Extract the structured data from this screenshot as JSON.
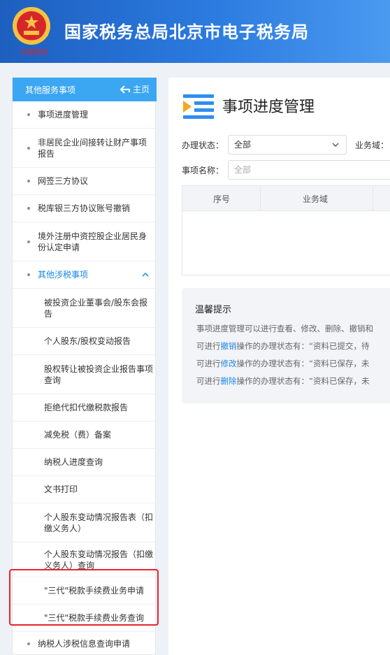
{
  "header": {
    "title": "国家税务总局北京市电子税务局",
    "emblem_text": "中国税务"
  },
  "sidebar": {
    "heading": "其他服务事项",
    "home_label": "主页",
    "items": [
      {
        "label": "事项进度管理"
      },
      {
        "label": "非居民企业间接转让财产事项报告"
      },
      {
        "label": "网签三方协议"
      },
      {
        "label": "税库银三方协议账号撤销"
      },
      {
        "label": "境外注册中资控股企业居民身份认定申请"
      },
      {
        "label": "其他涉税事项",
        "expanded": true
      },
      {
        "label": "被投资企业董事会/股东会报告"
      },
      {
        "label": "个人股东/股权变动报告"
      },
      {
        "label": "股权转让被投资企业报告事项查询"
      },
      {
        "label": "拒绝代扣代缴税款报告"
      },
      {
        "label": "减免税（费）备案"
      },
      {
        "label": "纳税人进度查询"
      },
      {
        "label": "文书打印"
      },
      {
        "label": "个人股东变动情况报告表（扣缴义务人）"
      },
      {
        "label": "个人股东变动情况报告（扣缴义务人）查询"
      },
      {
        "label": "\"三代\"税款手续费业务申请"
      },
      {
        "label": "\"三代\"税款手续费业务查询"
      },
      {
        "label": "纳税人涉税信息查询申请"
      }
    ]
  },
  "main": {
    "title": "事项进度管理",
    "status_label": "办理状态：",
    "status_value": "全部",
    "domain_label": "业务域：",
    "name_label": "事项名称：",
    "name_placeholder": "全部",
    "table_headers": [
      "序号",
      "业务域"
    ],
    "tips": {
      "title": "温馨提示",
      "line1": "事项进度管理可以进行查看、修改、删除、撤销和",
      "line2_prefix": "可进行",
      "line2_kw": "撤销",
      "line2_suffix": "操作的办理状态有：“资料已提交，待",
      "line3_prefix": "可进行",
      "line3_kw": "修改",
      "line3_suffix": "操作的办理状态有：“资料已保存，未",
      "line4_prefix": "可进行",
      "line4_kw": "删除",
      "line4_suffix": "操作的办理状态有：“资料已保存，未"
    }
  },
  "colors": {
    "header_blue": "#2c7be0",
    "sidebar_head": "#3ba6f2",
    "active_text": "#1a86e8",
    "highlight_red": "#e8242a"
  }
}
